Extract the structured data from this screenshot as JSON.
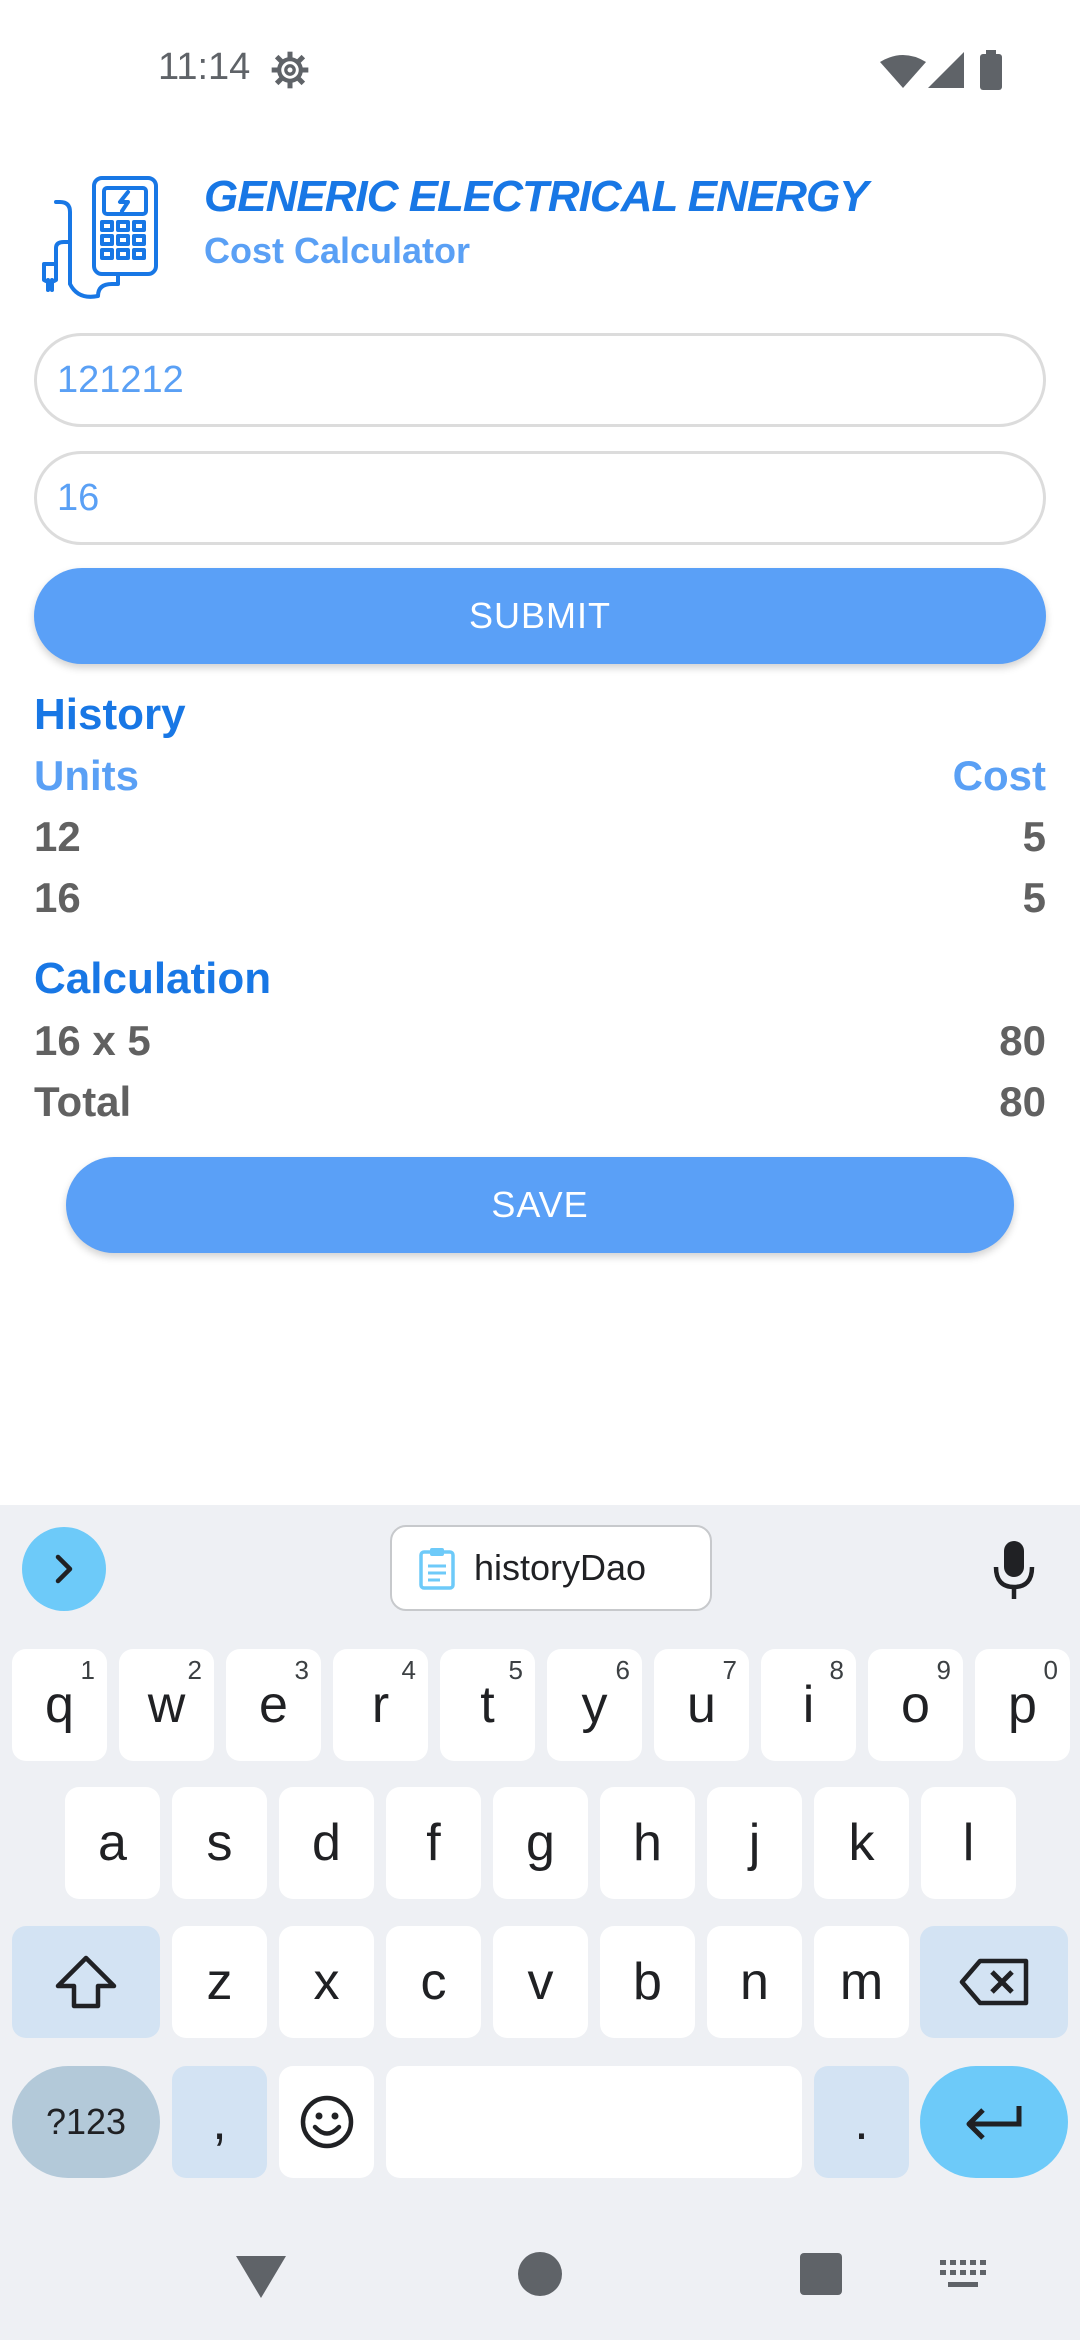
{
  "status_bar": {
    "time": "11:14"
  },
  "header": {
    "title": "GENERIC ELECTRICAL ENERGY",
    "subtitle": "Cost Calculator"
  },
  "form": {
    "units_value": "121212",
    "cost_value": "16",
    "submit_label": "SUBMIT"
  },
  "history": {
    "heading": "History",
    "col_units": "Units",
    "col_cost": "Cost",
    "rows": [
      {
        "units": "12",
        "cost": "5"
      },
      {
        "units": "16",
        "cost": "5"
      }
    ]
  },
  "calculation": {
    "heading": "Calculation",
    "expression": "16 x 5",
    "expression_value": "80",
    "total_label": "Total",
    "total_value": "80"
  },
  "save_label": "SAVE",
  "keyboard": {
    "suggestion": "historyDao",
    "row1": [
      {
        "key": "q",
        "hint": "1"
      },
      {
        "key": "w",
        "hint": "2"
      },
      {
        "key": "e",
        "hint": "3"
      },
      {
        "key": "r",
        "hint": "4"
      },
      {
        "key": "t",
        "hint": "5"
      },
      {
        "key": "y",
        "hint": "6"
      },
      {
        "key": "u",
        "hint": "7"
      },
      {
        "key": "i",
        "hint": "8"
      },
      {
        "key": "o",
        "hint": "9"
      },
      {
        "key": "p",
        "hint": "0"
      }
    ],
    "row2": [
      "a",
      "s",
      "d",
      "f",
      "g",
      "h",
      "j",
      "k",
      "l"
    ],
    "row3": [
      "z",
      "x",
      "c",
      "v",
      "b",
      "n",
      "m"
    ],
    "sym_label": "?123",
    "comma": ",",
    "period": "."
  },
  "colors": {
    "accent_dark": "#1877e5",
    "accent_light": "#5aa0f5",
    "button": "#5aa0f7",
    "keyboard_accent": "#6dcaf9"
  }
}
